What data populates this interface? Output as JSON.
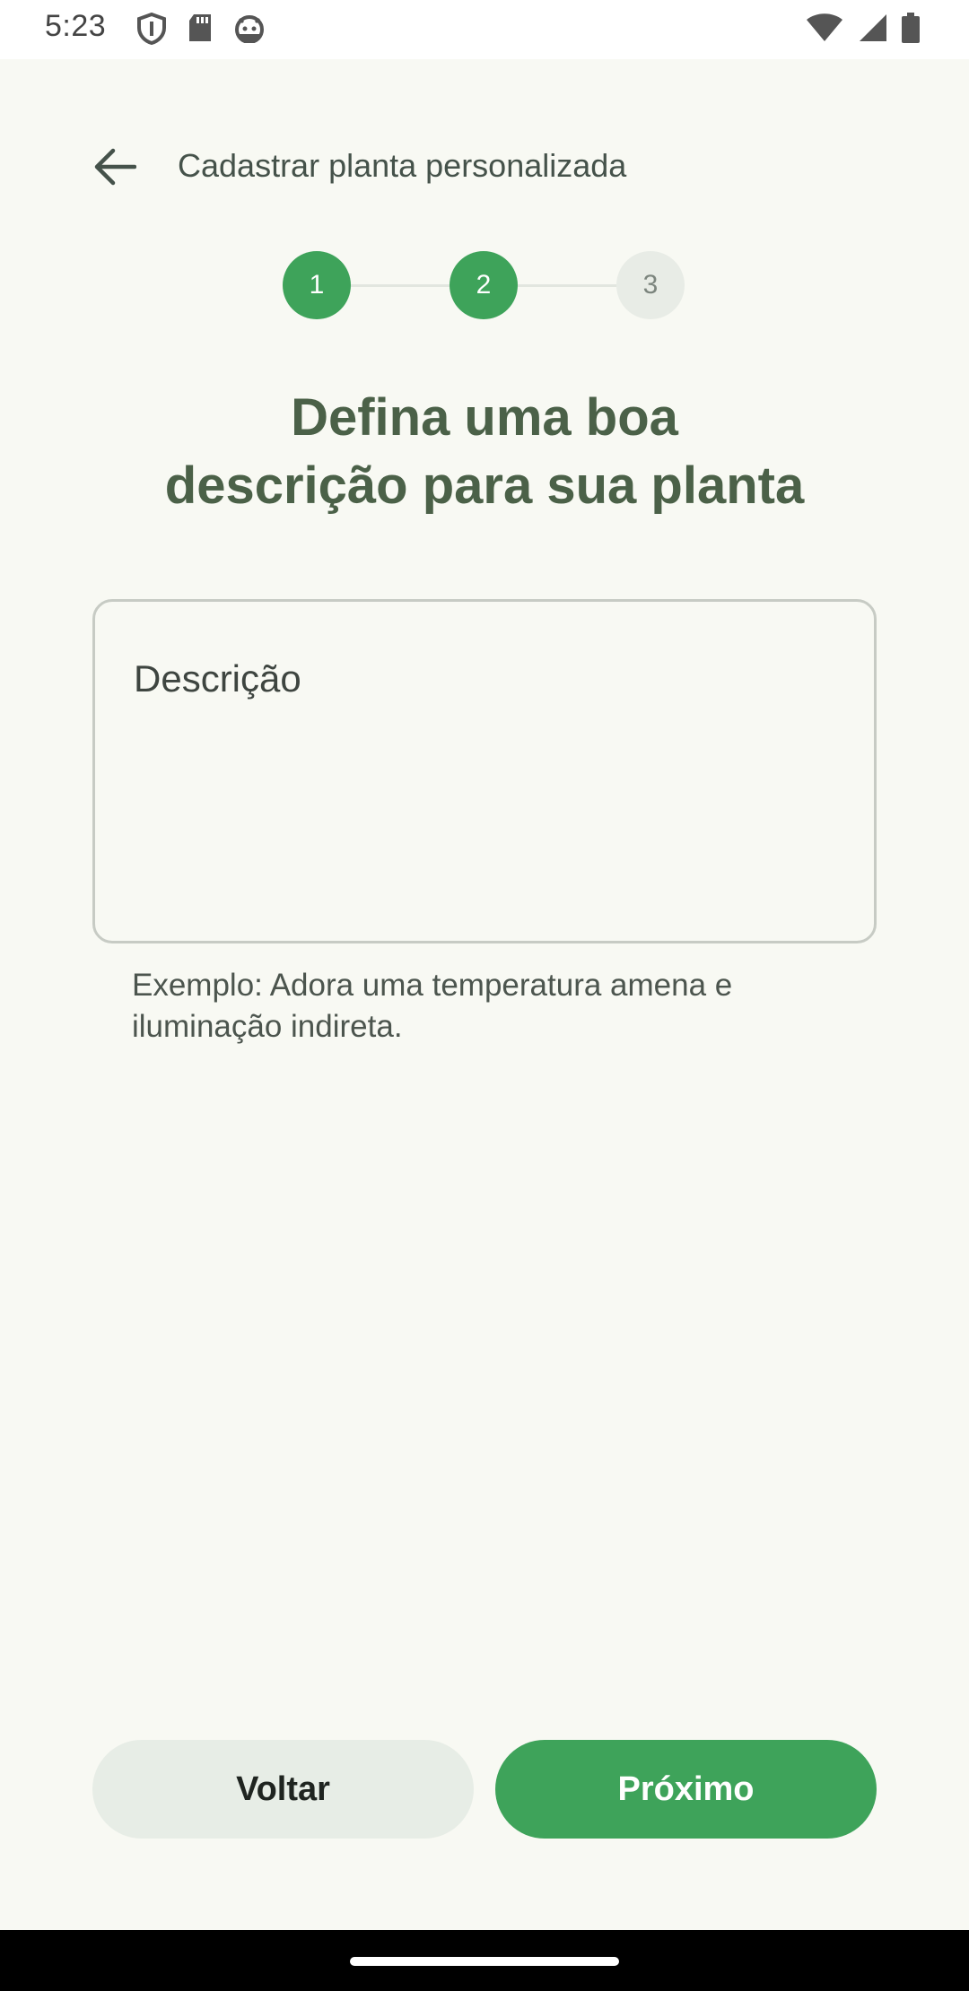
{
  "status_bar": {
    "time": "5:23",
    "left_icons": [
      "shield-icon",
      "sd-card-icon",
      "android-icon"
    ],
    "right_icons": [
      "wifi-icon",
      "signal-icon",
      "battery-icon"
    ]
  },
  "app_bar": {
    "title": "Cadastrar planta personalizada",
    "back_icon": "arrow-back-icon"
  },
  "stepper": {
    "steps": [
      {
        "label": "1",
        "state": "done"
      },
      {
        "label": "2",
        "state": "current"
      },
      {
        "label": "3",
        "state": "pending"
      }
    ]
  },
  "headline": {
    "line1": "Defina uma boa",
    "line2": "descrição para sua planta"
  },
  "description_field": {
    "label": "Descrição",
    "value": "",
    "helper": "Exemplo: Adora uma temperatura amena e iluminação indireta."
  },
  "actions": {
    "back_label": "Voltar",
    "next_label": "Próximo"
  },
  "colors": {
    "primary": "#3ea35a",
    "headline": "#4b6148",
    "background": "#f8f9f3"
  }
}
